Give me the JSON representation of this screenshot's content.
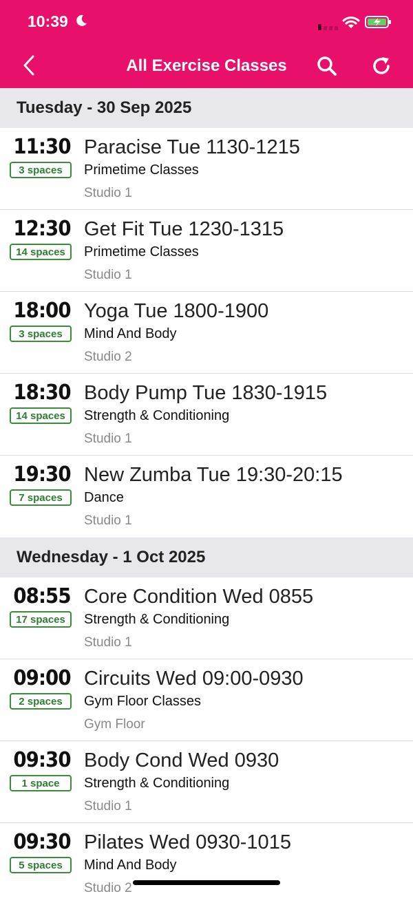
{
  "status": {
    "time": "10:39"
  },
  "nav": {
    "title": "All Exercise Classes"
  },
  "days": [
    {
      "header": "Tuesday - 30 Sep 2025",
      "classes": [
        {
          "time": "11:30",
          "spaces": "3 spaces",
          "name": "Paracise Tue 1130-1215",
          "category": "Primetime Classes",
          "location": "Studio 1"
        },
        {
          "time": "12:30",
          "spaces": "14 spaces",
          "name": "Get Fit Tue 1230-1315",
          "category": "Primetime Classes",
          "location": "Studio 1"
        },
        {
          "time": "18:00",
          "spaces": "3 spaces",
          "name": "Yoga Tue 1800-1900",
          "category": "Mind And Body",
          "location": "Studio 2"
        },
        {
          "time": "18:30",
          "spaces": "14 spaces",
          "name": "Body Pump Tue 1830-1915",
          "category": "Strength & Conditioning",
          "location": "Studio 1"
        },
        {
          "time": "19:30",
          "spaces": "7 spaces",
          "name": "New Zumba Tue 19:30-20:15",
          "category": "Dance",
          "location": "Studio 1"
        }
      ]
    },
    {
      "header": "Wednesday - 1 Oct 2025",
      "classes": [
        {
          "time": "08:55",
          "spaces": "17 spaces",
          "name": "Core Condition Wed 0855",
          "category": "Strength & Conditioning",
          "location": "Studio 1"
        },
        {
          "time": "09:00",
          "spaces": "2 spaces",
          "name": "Circuits Wed 09:00-0930",
          "category": "Gym Floor Classes",
          "location": "Gym Floor"
        },
        {
          "time": "09:30",
          "spaces": "1 space",
          "name": "Body Cond Wed 0930",
          "category": "Strength & Conditioning",
          "location": "Studio 1"
        },
        {
          "time": "09:30",
          "spaces": "5 spaces",
          "name": "Pilates Wed 0930-1015",
          "category": "Mind And Body",
          "location": "Studio 2"
        }
      ]
    }
  ],
  "icons": {
    "back": "chevron-left-icon",
    "search": "search-icon",
    "refresh": "refresh-icon"
  },
  "colors": {
    "accent": "#e8106a",
    "spaces_green": "#2e7d32",
    "header_bg": "#e7e7ec"
  }
}
